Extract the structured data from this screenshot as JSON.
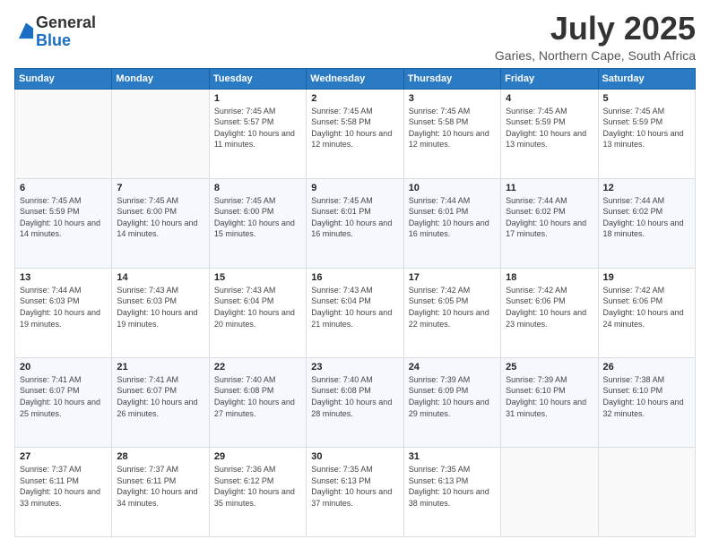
{
  "logo": {
    "general": "General",
    "blue": "Blue"
  },
  "title": "July 2025",
  "subtitle": "Garies, Northern Cape, South Africa",
  "header_days": [
    "Sunday",
    "Monday",
    "Tuesday",
    "Wednesday",
    "Thursday",
    "Friday",
    "Saturday"
  ],
  "weeks": [
    [
      {
        "day": "",
        "info": ""
      },
      {
        "day": "",
        "info": ""
      },
      {
        "day": "1",
        "info": "Sunrise: 7:45 AM\nSunset: 5:57 PM\nDaylight: 10 hours and 11 minutes."
      },
      {
        "day": "2",
        "info": "Sunrise: 7:45 AM\nSunset: 5:58 PM\nDaylight: 10 hours and 12 minutes."
      },
      {
        "day": "3",
        "info": "Sunrise: 7:45 AM\nSunset: 5:58 PM\nDaylight: 10 hours and 12 minutes."
      },
      {
        "day": "4",
        "info": "Sunrise: 7:45 AM\nSunset: 5:59 PM\nDaylight: 10 hours and 13 minutes."
      },
      {
        "day": "5",
        "info": "Sunrise: 7:45 AM\nSunset: 5:59 PM\nDaylight: 10 hours and 13 minutes."
      }
    ],
    [
      {
        "day": "6",
        "info": "Sunrise: 7:45 AM\nSunset: 5:59 PM\nDaylight: 10 hours and 14 minutes."
      },
      {
        "day": "7",
        "info": "Sunrise: 7:45 AM\nSunset: 6:00 PM\nDaylight: 10 hours and 14 minutes."
      },
      {
        "day": "8",
        "info": "Sunrise: 7:45 AM\nSunset: 6:00 PM\nDaylight: 10 hours and 15 minutes."
      },
      {
        "day": "9",
        "info": "Sunrise: 7:45 AM\nSunset: 6:01 PM\nDaylight: 10 hours and 16 minutes."
      },
      {
        "day": "10",
        "info": "Sunrise: 7:44 AM\nSunset: 6:01 PM\nDaylight: 10 hours and 16 minutes."
      },
      {
        "day": "11",
        "info": "Sunrise: 7:44 AM\nSunset: 6:02 PM\nDaylight: 10 hours and 17 minutes."
      },
      {
        "day": "12",
        "info": "Sunrise: 7:44 AM\nSunset: 6:02 PM\nDaylight: 10 hours and 18 minutes."
      }
    ],
    [
      {
        "day": "13",
        "info": "Sunrise: 7:44 AM\nSunset: 6:03 PM\nDaylight: 10 hours and 19 minutes."
      },
      {
        "day": "14",
        "info": "Sunrise: 7:43 AM\nSunset: 6:03 PM\nDaylight: 10 hours and 19 minutes."
      },
      {
        "day": "15",
        "info": "Sunrise: 7:43 AM\nSunset: 6:04 PM\nDaylight: 10 hours and 20 minutes."
      },
      {
        "day": "16",
        "info": "Sunrise: 7:43 AM\nSunset: 6:04 PM\nDaylight: 10 hours and 21 minutes."
      },
      {
        "day": "17",
        "info": "Sunrise: 7:42 AM\nSunset: 6:05 PM\nDaylight: 10 hours and 22 minutes."
      },
      {
        "day": "18",
        "info": "Sunrise: 7:42 AM\nSunset: 6:06 PM\nDaylight: 10 hours and 23 minutes."
      },
      {
        "day": "19",
        "info": "Sunrise: 7:42 AM\nSunset: 6:06 PM\nDaylight: 10 hours and 24 minutes."
      }
    ],
    [
      {
        "day": "20",
        "info": "Sunrise: 7:41 AM\nSunset: 6:07 PM\nDaylight: 10 hours and 25 minutes."
      },
      {
        "day": "21",
        "info": "Sunrise: 7:41 AM\nSunset: 6:07 PM\nDaylight: 10 hours and 26 minutes."
      },
      {
        "day": "22",
        "info": "Sunrise: 7:40 AM\nSunset: 6:08 PM\nDaylight: 10 hours and 27 minutes."
      },
      {
        "day": "23",
        "info": "Sunrise: 7:40 AM\nSunset: 6:08 PM\nDaylight: 10 hours and 28 minutes."
      },
      {
        "day": "24",
        "info": "Sunrise: 7:39 AM\nSunset: 6:09 PM\nDaylight: 10 hours and 29 minutes."
      },
      {
        "day": "25",
        "info": "Sunrise: 7:39 AM\nSunset: 6:10 PM\nDaylight: 10 hours and 31 minutes."
      },
      {
        "day": "26",
        "info": "Sunrise: 7:38 AM\nSunset: 6:10 PM\nDaylight: 10 hours and 32 minutes."
      }
    ],
    [
      {
        "day": "27",
        "info": "Sunrise: 7:37 AM\nSunset: 6:11 PM\nDaylight: 10 hours and 33 minutes."
      },
      {
        "day": "28",
        "info": "Sunrise: 7:37 AM\nSunset: 6:11 PM\nDaylight: 10 hours and 34 minutes."
      },
      {
        "day": "29",
        "info": "Sunrise: 7:36 AM\nSunset: 6:12 PM\nDaylight: 10 hours and 35 minutes."
      },
      {
        "day": "30",
        "info": "Sunrise: 7:35 AM\nSunset: 6:13 PM\nDaylight: 10 hours and 37 minutes."
      },
      {
        "day": "31",
        "info": "Sunrise: 7:35 AM\nSunset: 6:13 PM\nDaylight: 10 hours and 38 minutes."
      },
      {
        "day": "",
        "info": ""
      },
      {
        "day": "",
        "info": ""
      }
    ]
  ]
}
